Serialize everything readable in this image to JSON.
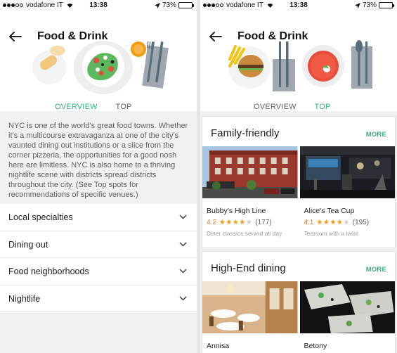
{
  "left": {
    "status": {
      "carrier": "vodafone IT",
      "time": "13:38",
      "battery": "73%",
      "battery_level": 0.73
    },
    "title": "Food & Drink",
    "tabs": [
      "OVERVIEW",
      "TOP SPOTS"
    ],
    "active_tab": "OVERVIEW",
    "intro": "NYC is one of the world's great food towns. Whether it's a multicourse extravaganza at one of the city's vaunted dining out institutions or a slice from the corner pizzeria, the opportunities for a good nosh here are limitless. NYC is also home to a thriving nightlife scene with districts spread districts throughout the city. (See Top spots for recommendations of specific venues.)",
    "sections": [
      {
        "label": "Local specialties",
        "icon": "chevron-down-icon"
      },
      {
        "label": "Dining out",
        "icon": "chevron-down-icon"
      },
      {
        "label": "Food neighborhoods",
        "icon": "chevron-down-icon"
      },
      {
        "label": "Nightlife",
        "icon": "chevron-down-icon"
      }
    ]
  },
  "right": {
    "status": {
      "carrier": "vodafone IT",
      "time": "13:38",
      "battery": "73%",
      "battery_level": 0.73
    },
    "title": "Food & Drink",
    "tabs": [
      "OVERVIEW",
      "TOP SPOTS"
    ],
    "active_tab": "TOP SPOTS",
    "cards": [
      {
        "title": "Family-friendly",
        "more": "MORE",
        "places": [
          {
            "name": "Bubby's High Line",
            "rating": "4.2",
            "stars": 4.2,
            "reviews": "(177)",
            "desc": "Diner classics served all day"
          },
          {
            "name": "Alice's Tea Cup",
            "rating": "4.1",
            "stars": 4.1,
            "reviews": "(195)",
            "desc": "Tearoom with a twist"
          }
        ]
      },
      {
        "title": "High-End dining",
        "more": "MORE",
        "places": [
          {
            "name": "Annisa"
          },
          {
            "name": "Betony"
          }
        ]
      }
    ]
  },
  "colors": {
    "accent": "#2eb67d",
    "rating": "#e67e22",
    "star": "#f39c12"
  }
}
